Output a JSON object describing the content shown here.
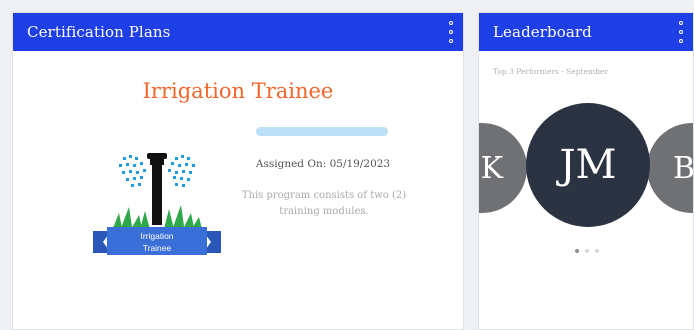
{
  "certification": {
    "title": "Certification Plans",
    "program": {
      "title": "Irrigation Trainee",
      "badge_text": [
        "Irrigation",
        "Trainee"
      ],
      "assigned": "Assigned On: 05/19/2023",
      "description": "This program consists of two (2) training modules.",
      "progress": 1.0
    }
  },
  "leaderboard": {
    "title": "Leaderboard",
    "period": "Top 3 Performers - September",
    "entries": [
      {
        "initials": "K"
      },
      {
        "initials": "JM"
      },
      {
        "initials": "B"
      }
    ],
    "active_index": 0,
    "dot_count": 3
  },
  "colors": {
    "header": "#1f3fe6",
    "accent": "#f2662a",
    "avatar": "#2b3342",
    "avatar_side": "#6f7175"
  }
}
